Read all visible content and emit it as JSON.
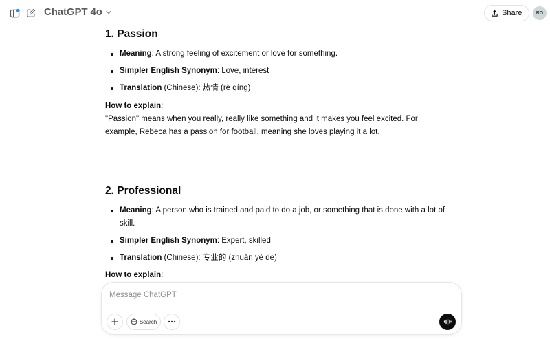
{
  "header": {
    "model_name": "ChatGPT 4o",
    "share_label": "Share",
    "avatar_initials": "RO",
    "icons": [
      "sidebar-toggle-icon",
      "new-chat-icon",
      "chevron-down-icon",
      "share-icon"
    ]
  },
  "sections": [
    {
      "title": "1. Passion",
      "meaning_label": "Meaning",
      "meaning": ": A strong feeling of excitement or love for something.",
      "synonym_label": "Simpler English Synonym",
      "synonym": ": Love, interest",
      "translation_label": "Translation",
      "translation": " (Chinese): 热情 (rè qíng)",
      "explain_head": "How to explain",
      "explain_colon": ":",
      "explain_body": "\"Passion\" means when you really, really like something and it makes you feel excited. For example, Rebeca has a passion for football, meaning she loves playing it a lot."
    },
    {
      "title": "2. Professional",
      "meaning_label": "Meaning",
      "meaning": ": A person who is trained and paid to do a job, or something that is done with a lot of skill.",
      "synonym_label": "Simpler English Synonym",
      "synonym": ": Expert, skilled",
      "translation_label": "Translation",
      "translation": " (Chinese): 专业的 (zhuān yè de)",
      "explain_head": "How to explain",
      "explain_colon": ":"
    }
  ],
  "composer": {
    "placeholder": "Message ChatGPT",
    "search_label": "Search",
    "icons": [
      "plus-icon",
      "globe-icon",
      "more-icon",
      "voice-mode-icon"
    ]
  }
}
